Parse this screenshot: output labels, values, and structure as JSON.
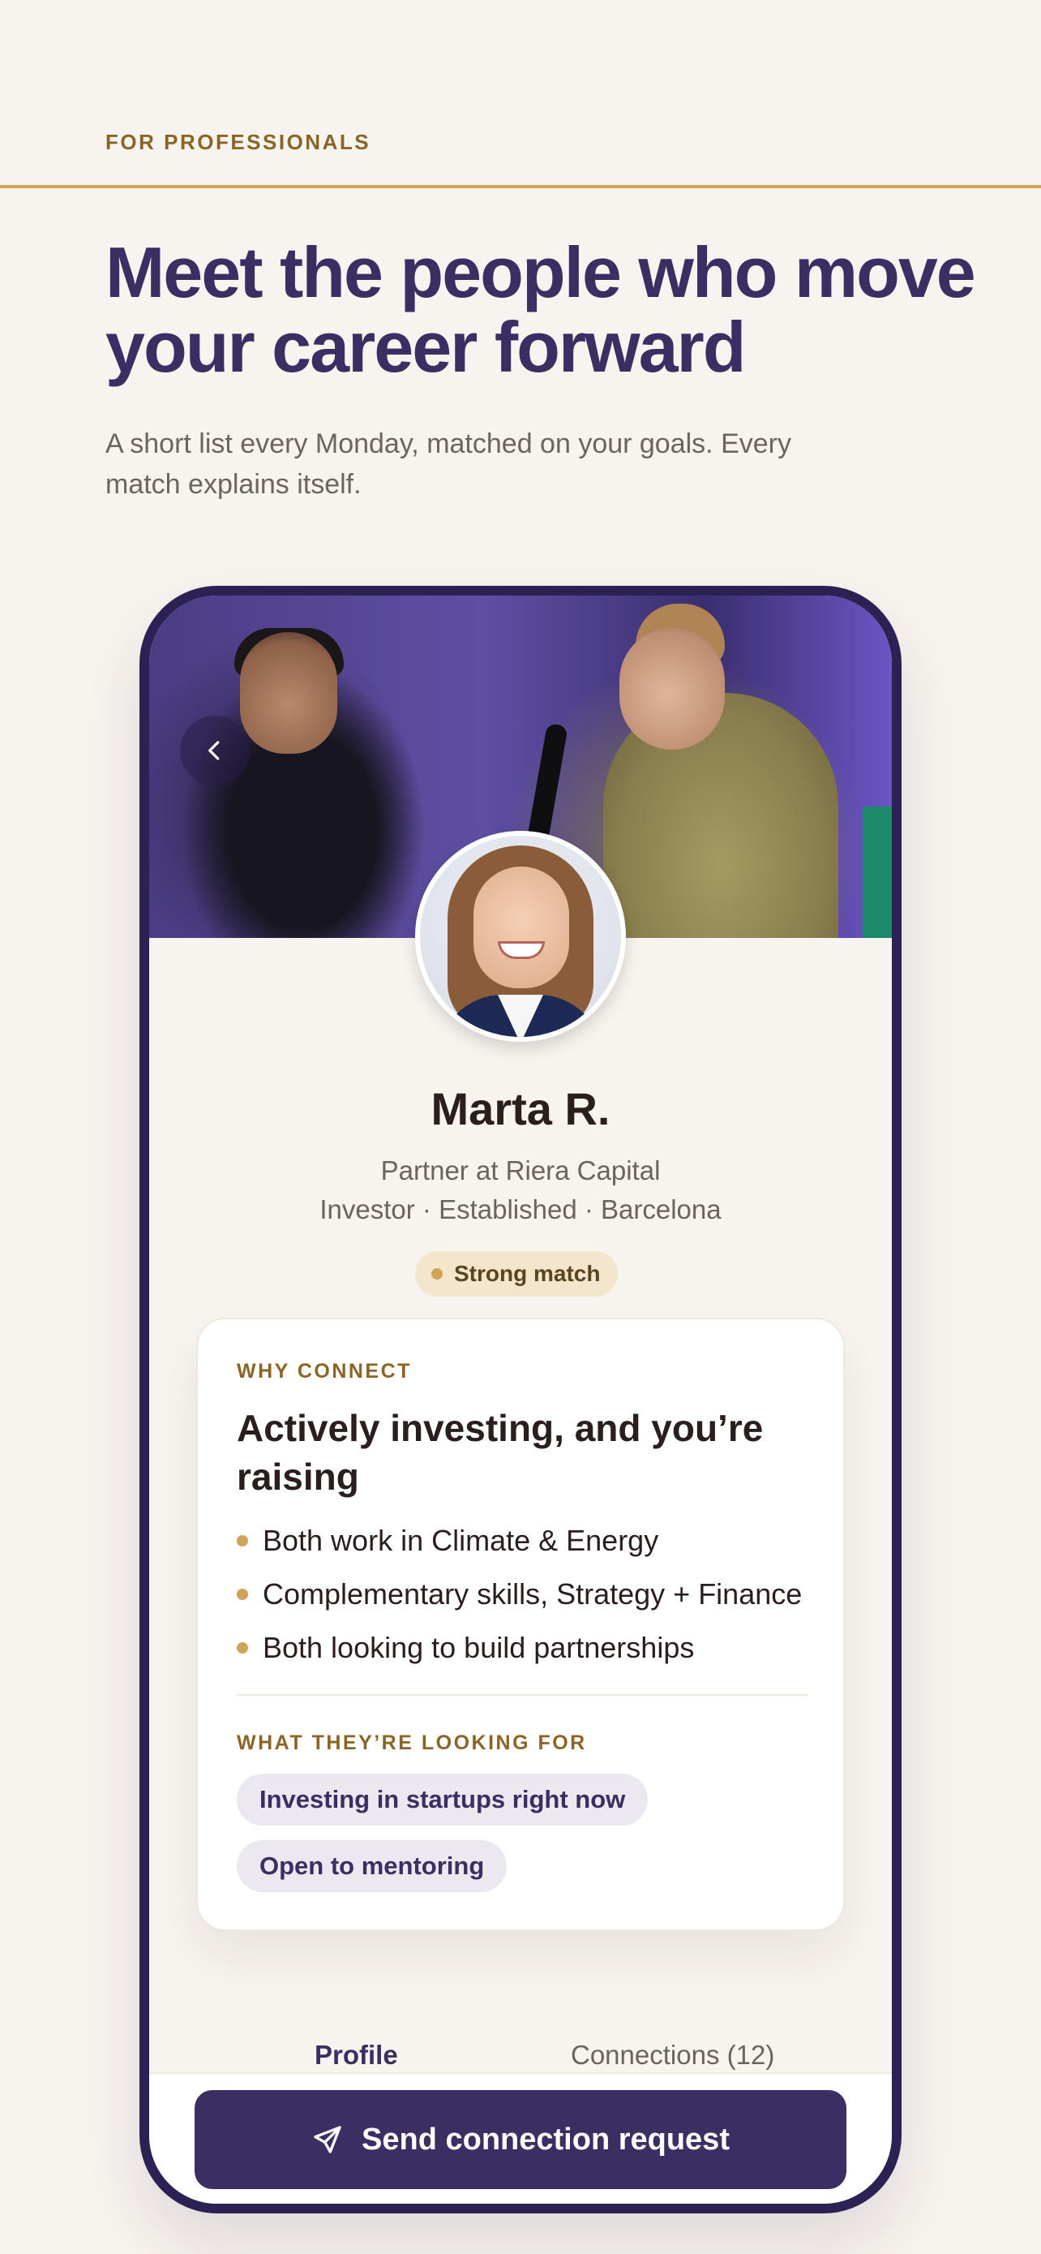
{
  "header": {
    "eyebrow": "FOR PROFESSIONALS",
    "headline": "Meet the people who move your career forward",
    "subhead": "A short list every Monday, matched on your goals. Every match explains itself."
  },
  "profile": {
    "back_icon": "chevron-left-icon",
    "name": "Marta R.",
    "role": "Partner at Riera Capital",
    "meta": "Investor · Established · Barcelona",
    "badge": "Strong match"
  },
  "why_connect": {
    "eyebrow": "WHY CONNECT",
    "title": "Actively investing, and you’re raising",
    "reasons": [
      "Both work in Climate & Energy",
      "Complementary skills, Strategy + Finance",
      "Both looking to build partnerships"
    ],
    "looking_for_eyebrow": "WHAT THEY’RE LOOKING FOR",
    "chips": [
      "Investing in startups right now",
      "Open to mentoring"
    ]
  },
  "tabs": {
    "profile": "Profile",
    "connections": "Connections (12)"
  },
  "cta": {
    "label": "Send connection request",
    "icon": "send-icon"
  },
  "colors": {
    "background": "#f7f3ee",
    "accent_gold": "#d1a55c",
    "brand_purple": "#3a2e63",
    "phone_frame": "#2b2153"
  }
}
